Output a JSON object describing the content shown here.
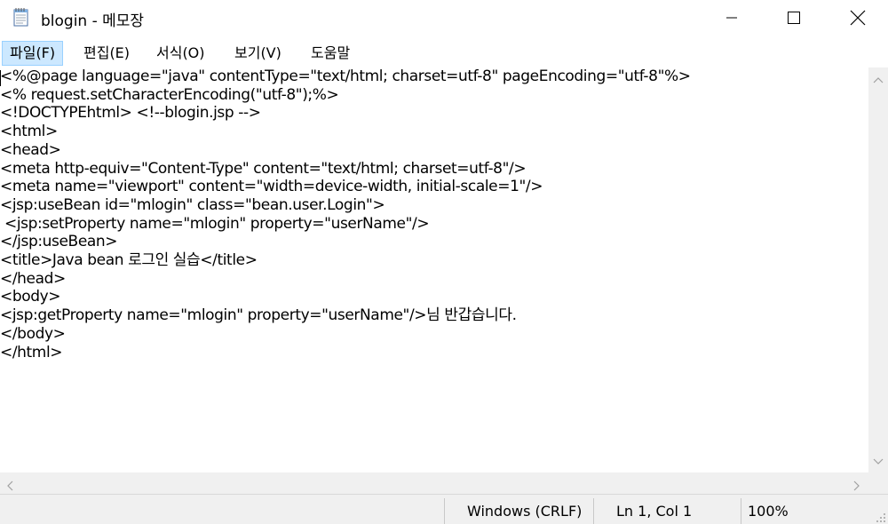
{
  "window": {
    "title": "blogin - 메모장",
    "icon": "notepad-icon"
  },
  "menu": {
    "items": [
      {
        "label": "파일(F)"
      },
      {
        "label": "편집(E)"
      },
      {
        "label": "서식(O)"
      },
      {
        "label": "보기(V)"
      },
      {
        "label": "도움말"
      }
    ]
  },
  "editor": {
    "lines": [
      "<%@page language=\"java\" contentType=\"text/html; charset=utf-8\" pageEncoding=\"utf-8\"%>",
      "<% request.setCharacterEncoding(\"utf-8\");%>",
      "<!DOCTYPEhtml> <!--blogin.jsp -->",
      "<html>",
      "<head>",
      "<meta http-equiv=\"Content-Type\" content=\"text/html; charset=utf-8\"/>",
      "<meta name=\"viewport\" content=\"width=device-width, initial-scale=1\"/>",
      "<jsp:useBean id=\"mlogin\" class=\"bean.user.Login\">",
      " <jsp:setProperty name=\"mlogin\" property=\"userName\"/>",
      "</jsp:useBean>",
      "<title>Java bean 로그인 실습</title>",
      "</head>",
      "<body>",
      "<jsp:getProperty name=\"mlogin\" property=\"userName\"/>님 반갑습니다.",
      "</body>",
      "</html>"
    ]
  },
  "status": {
    "line_ending": "Windows (CRLF)",
    "position": "Ln 1, Col 1",
    "zoom": "100%"
  }
}
